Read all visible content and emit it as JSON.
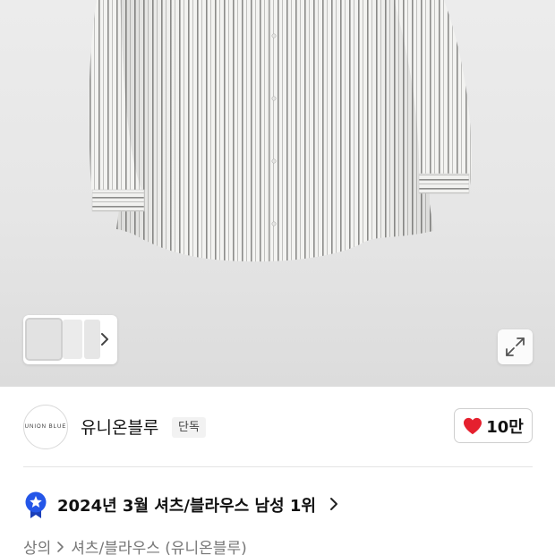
{
  "gallery": {
    "image_description": "white shirt with gray pinstripes, product photo",
    "expand_icon": "expand-icon",
    "thumbnail_next_icon": "chevron-right-icon"
  },
  "brand": {
    "logo_text": "UNION BLUE",
    "name": "유니온블루",
    "badge": "단독"
  },
  "like": {
    "icon": "heart-icon",
    "count": "10만",
    "color": "#e5202e"
  },
  "ranking": {
    "icon": "ranking-medal-icon",
    "text": "2024년 3월 셔츠/블라우스 남성 1위",
    "badge_color": "#2456e8"
  },
  "breadcrumb": {
    "items": [
      "상의",
      "셔츠/블라우스 (유니온블루)"
    ]
  }
}
